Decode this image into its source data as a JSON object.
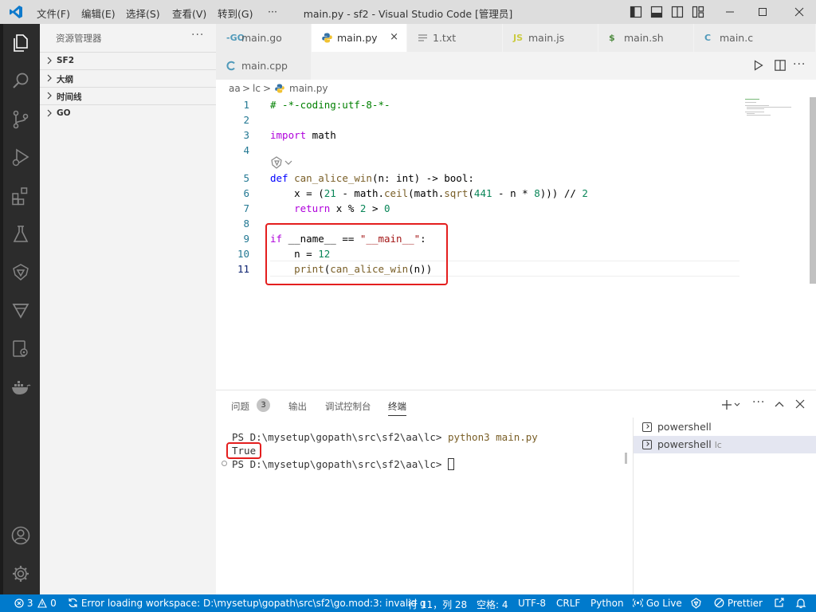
{
  "titlebar": {
    "menu": [
      "文件(F)",
      "编辑(E)",
      "选择(S)",
      "查看(V)",
      "转到(G)",
      "···"
    ],
    "title": "main.py - sf2 - Visual Studio Code [管理员]"
  },
  "sidebar": {
    "title": "资源管理器",
    "more": "···",
    "sections": [
      "SF2",
      "大纲",
      "时间线",
      "GO"
    ]
  },
  "tabs": [
    {
      "icon": "-GO",
      "label": "main.go",
      "icon_color": "#519aba"
    },
    {
      "icon": "py",
      "label": "main.py",
      "icon_color": "#3572a5",
      "active": true,
      "close": "×"
    },
    {
      "icon": "txt",
      "label": "1.txt",
      "icon_color": "#8a8a8a"
    },
    {
      "icon": "JS",
      "label": "main.js",
      "icon_color": "#cbcb41"
    },
    {
      "icon": "$",
      "label": "main.sh",
      "icon_color": "#4d5a5e"
    },
    {
      "icon": "C",
      "label": "main.c",
      "icon_color": "#519aba"
    },
    {
      "icon": "cpp",
      "label": "main.cpp",
      "icon_color": "#519aba"
    }
  ],
  "breadcrumb": [
    "aa",
    ">",
    "lc",
    ">",
    "main.py"
  ],
  "editor": {
    "line_numbers": [
      "1",
      "2",
      "3",
      "4",
      "5",
      "6",
      "7",
      "8",
      "9",
      "10",
      "11"
    ],
    "code": {
      "l1": "# -*-coding:utf-8-*-",
      "l3_kw": "import",
      "l3_rest": " math",
      "l5_kw": "def",
      "l5_fn": "can_alice_win",
      "l5_rest": "(n: int) -> bool:",
      "l6_pre": "    x = (",
      "l6_n1": "21",
      "l6_mid": " - math.",
      "l6_f1": "ceil",
      "l6_mid2": "(math.",
      "l6_f2": "sqrt",
      "l6_p": "(",
      "l6_n2": "441",
      "l6_mid3": " - n * ",
      "l6_n3": "8",
      "l6_end": "))) // ",
      "l6_n4": "2",
      "l7_kw": "    return",
      "l7_rest": " x % ",
      "l7_n1": "2",
      "l7_mid": " > ",
      "l7_n2": "0",
      "l9_kw": "if",
      "l9_rest": " __name__ == ",
      "l9_str": "\"__main__\"",
      "l9_end": ":",
      "l10_pre": "    n = ",
      "l10_num": "12",
      "l11_pre": "    ",
      "l11_fn": "print",
      "l11_p": "(",
      "l11_fn2": "can_alice_win",
      "l11_rest": "(n))"
    }
  },
  "panel": {
    "tabs": [
      {
        "label": "问题",
        "badge": "3"
      },
      {
        "label": "输出"
      },
      {
        "label": "调试控制台"
      },
      {
        "label": "终端",
        "active": true
      }
    ],
    "terminal": {
      "line1_prompt": "PS D:\\mysetup\\gopath\\src\\sf2\\aa\\lc> ",
      "line1_cmd": "python3 main.py",
      "line2": "True",
      "line3_prompt": "PS D:\\mysetup\\gopath\\src\\sf2\\aa\\lc> "
    },
    "terminal_list": [
      {
        "label": "powershell",
        "sub": ""
      },
      {
        "label": "powershell",
        "sub": "lc",
        "selected": true
      }
    ]
  },
  "statusbar": {
    "errors": "3",
    "warnings": "0",
    "workspace_msg": "Error loading workspace: D:\\mysetup\\gopath\\src\\sf2\\go.mod:3: invalid g",
    "position": "行 11，列 28",
    "spaces": "空格: 4",
    "encoding": "UTF-8",
    "eol": "CRLF",
    "language": "Python",
    "golive": "Go Live",
    "prettier": "Prettier"
  },
  "colors": {
    "statusbar": "#007acc",
    "activitybar": "#2c2c2c",
    "highlight_box": "#e41e1e"
  }
}
